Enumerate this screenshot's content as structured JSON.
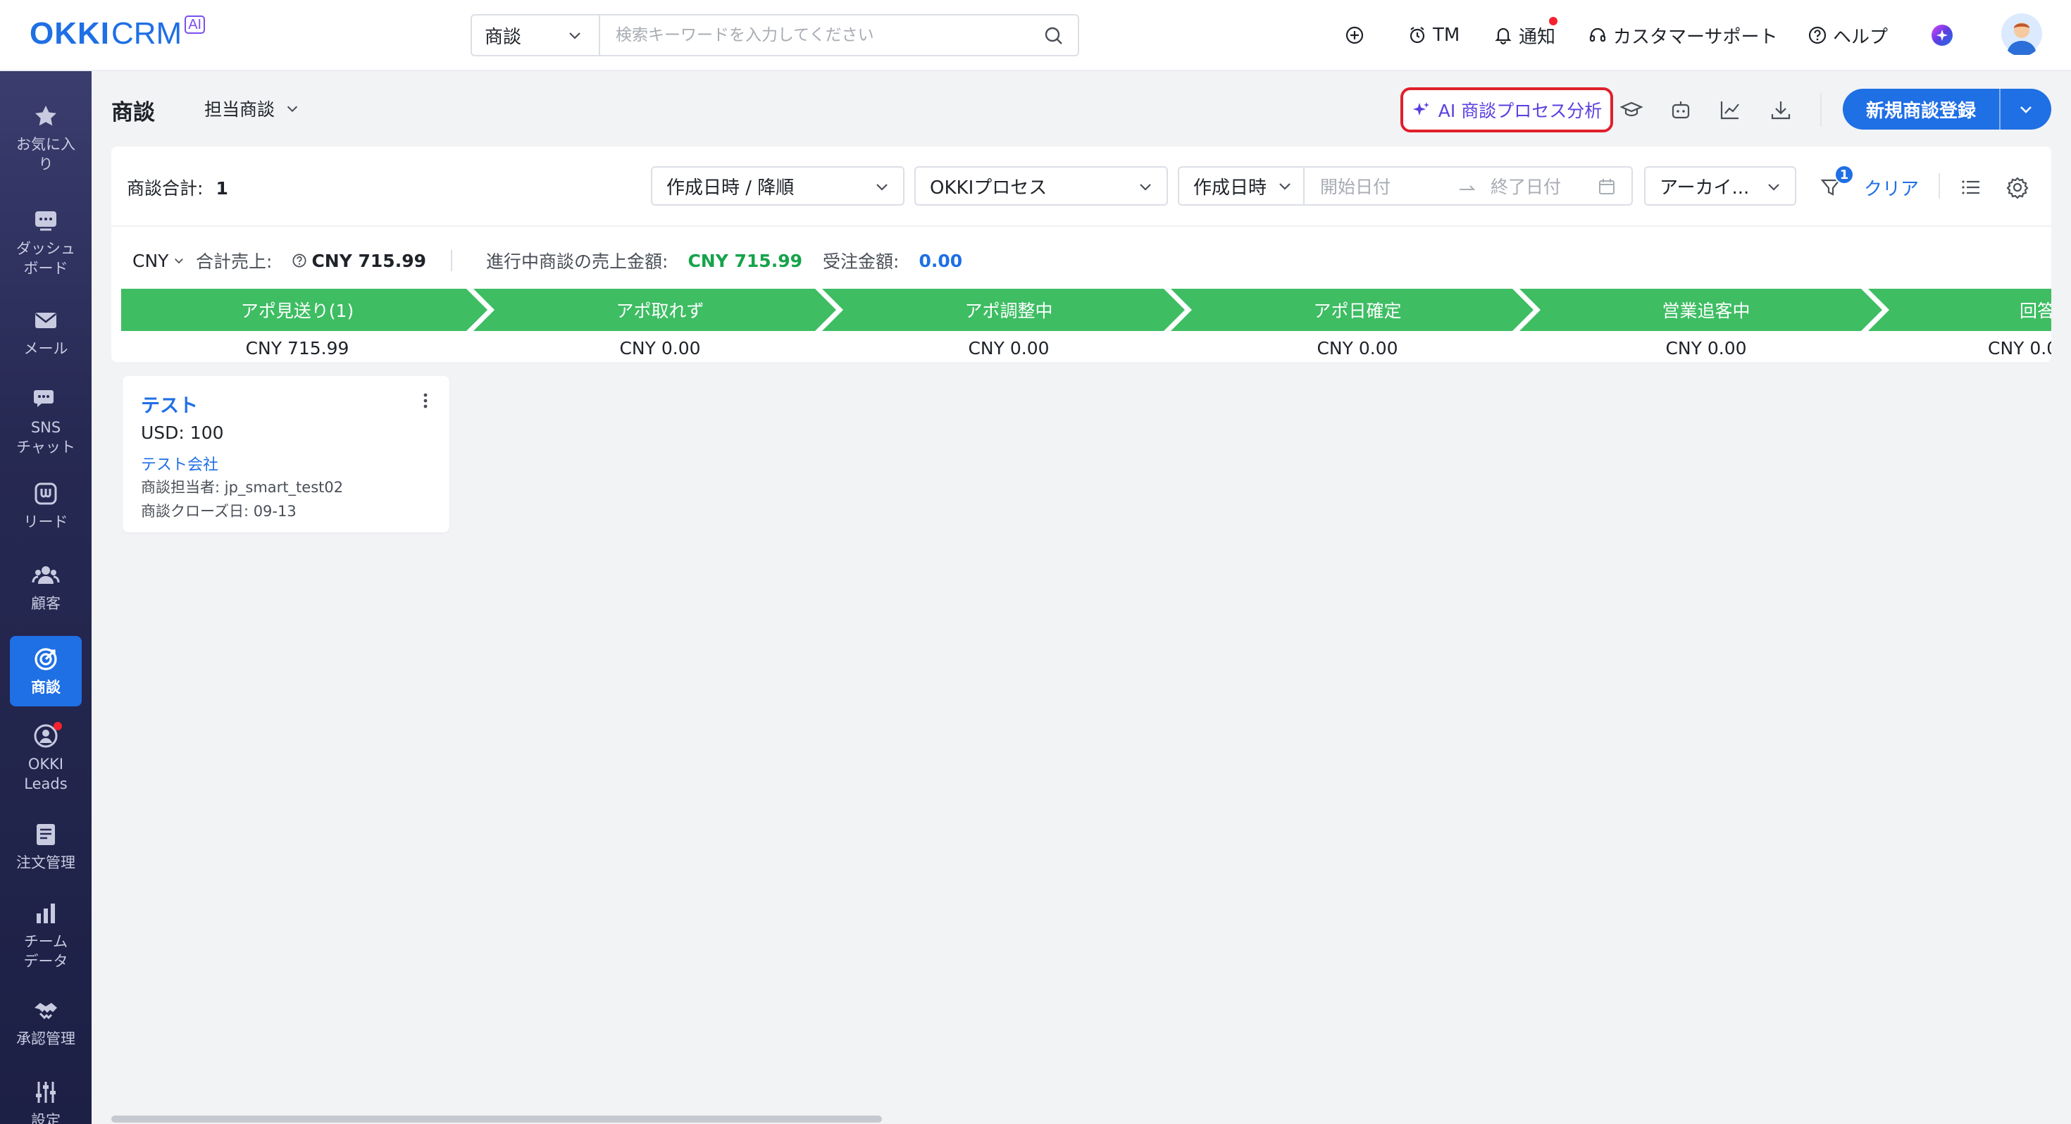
{
  "topbar": {
    "logo": {
      "okki": "OKKI",
      "crm": "CRM",
      "ai": "AI"
    },
    "search": {
      "scope": "商談",
      "placeholder": "検索キーワードを入力してください"
    },
    "actions": {
      "tm": "TM",
      "notify": "通知",
      "support": "カスタマーサポート",
      "help": "ヘルプ"
    }
  },
  "sidebar": {
    "items": [
      {
        "label": "お気に入り",
        "lines": [
          "お気に入",
          "り"
        ],
        "icon": "star-icon"
      },
      {
        "label": "ダッシュボード",
        "lines": [
          "ダッシュ",
          "ボード"
        ],
        "icon": "dashboard-icon"
      },
      {
        "label": "メール",
        "lines": [
          "メール"
        ],
        "icon": "mail-icon"
      },
      {
        "label": "SNSチャット",
        "lines": [
          "SNS",
          "チャット"
        ],
        "icon": "chat-icon"
      },
      {
        "label": "リード",
        "lines": [
          "リード"
        ],
        "icon": "lead-icon"
      },
      {
        "label": "顧客",
        "lines": [
          "顧客"
        ],
        "icon": "customers-icon"
      },
      {
        "label": "商談",
        "lines": [
          "商談"
        ],
        "icon": "target-icon",
        "active": true
      },
      {
        "label": "OKKI Leads",
        "lines": [
          "OKKI",
          "Leads"
        ],
        "icon": "okki-leads-icon"
      },
      {
        "label": "注文管理",
        "lines": [
          "注文管理"
        ],
        "icon": "order-icon"
      },
      {
        "label": "チームデータ",
        "lines": [
          "チーム",
          "データ"
        ],
        "icon": "bar-chart-icon"
      },
      {
        "label": "承認管理",
        "lines": [
          "承認管理"
        ],
        "icon": "handshake-icon"
      },
      {
        "label": "設定",
        "lines": [
          "設定"
        ],
        "icon": "settings-sliders-icon"
      }
    ]
  },
  "header": {
    "title": "商談",
    "view": "担当商談",
    "ai_button": "AI 商談プロセス分析",
    "new_button": "新規商談登録"
  },
  "filters": {
    "count_label": "商談合計:",
    "count_value": "1",
    "sort": "作成日時 / 降順",
    "process": "OKKIプロセス",
    "date_type": "作成日時",
    "start_placeholder": "開始日付",
    "end_placeholder": "終了日付",
    "archive": "アーカイ...",
    "filter_count": "1",
    "clear": "クリア"
  },
  "summary": {
    "currency": "CNY",
    "total_label": "合計売上:",
    "total_value": "CNY 715.99",
    "ongoing_label": "進行中商談の売上金額:",
    "ongoing_value": "CNY 715.99",
    "won_label": "受注金額:",
    "won_value": "0.00"
  },
  "stages": [
    {
      "name": "アポ見送り(1)",
      "amount": "CNY 715.99"
    },
    {
      "name": "アポ取れず",
      "amount": "CNY 0.00"
    },
    {
      "name": "アポ調整中",
      "amount": "CNY 0.00"
    },
    {
      "name": "アポ日確定",
      "amount": "CNY 0.00"
    },
    {
      "name": "営業追客中",
      "amount": "CNY 0.00"
    },
    {
      "name": "回答待ち",
      "amount": "CNY 0.0"
    }
  ],
  "card": {
    "title": "テスト",
    "amount": "USD: 100",
    "company": "テスト会社",
    "owner": "商談担当者: jp_smart_test02",
    "close_date": "商談クローズ日: 09-13"
  },
  "colors": {
    "primary": "#1f6fe5",
    "stage_green": "#3ebd63",
    "ongoing_green": "#16a34a",
    "ai_purple": "#5b3fe0",
    "highlight_red": "#e0202a"
  }
}
